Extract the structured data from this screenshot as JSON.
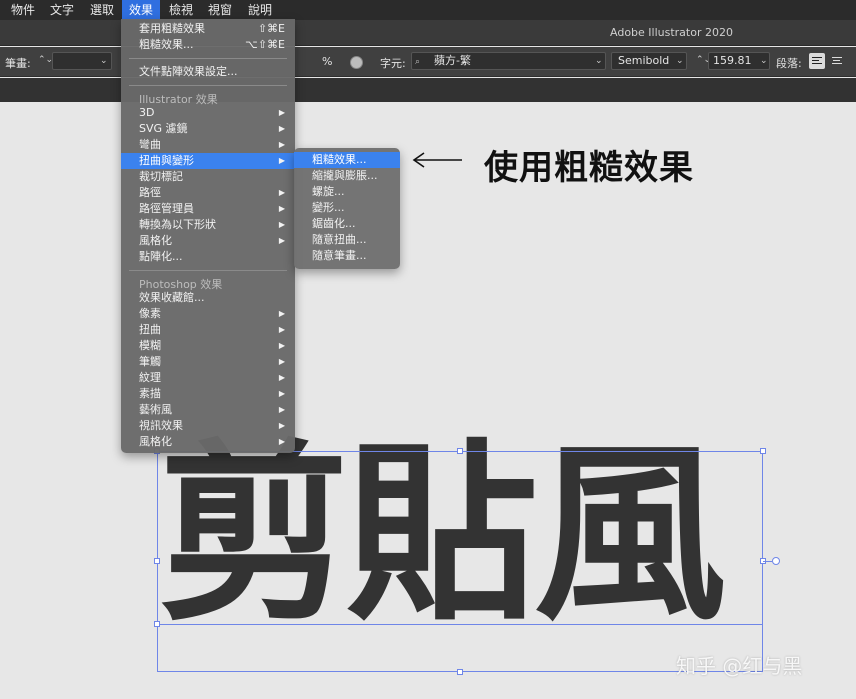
{
  "menubar": {
    "items": [
      "物件",
      "文字",
      "選取",
      "效果",
      "檢視",
      "視窗",
      "說明"
    ],
    "active": "效果"
  },
  "titlebar": {
    "title": "Adobe Illustrator 2020"
  },
  "controlbar": {
    "stroke_label": "筆畫:",
    "opacity_suffix": "%",
    "char_label": "字元:",
    "font_family": "蘋方-繁",
    "font_style": "Semibold",
    "font_size": "159.81",
    "paragraph_label": "段落:"
  },
  "effect_menu": {
    "apply_last": {
      "label": "套用粗糙效果",
      "shortcut": "⇧⌘E"
    },
    "last_effect": {
      "label": "粗糙效果...",
      "shortcut": "⌥⇧⌘E"
    },
    "raster_settings": "文件點陣效果設定...",
    "illustrator_header": "Illustrator 效果",
    "illustrator_items": [
      "3D",
      "SVG 濾鏡",
      "彎曲",
      "扭曲與變形",
      "裁切標記",
      "路徑",
      "路徑管理員",
      "轉換為以下形狀",
      "風格化",
      "點陣化..."
    ],
    "photoshop_header": "Photoshop 效果",
    "photoshop_items": [
      "效果收藏館...",
      "像素",
      "扭曲",
      "模糊",
      "筆觸",
      "紋理",
      "素描",
      "藝術風",
      "視訊效果",
      "風格化"
    ]
  },
  "submenu": {
    "items": [
      "粗糙效果...",
      "縮攏與膨脹...",
      "螺旋...",
      "變形...",
      "鋸齒化...",
      "隨意扭曲...",
      "隨意筆畫..."
    ]
  },
  "annotation": {
    "text": "使用粗糙效果"
  },
  "canvas_text": "剪貼風",
  "watermark": "知乎 @红与黑"
}
